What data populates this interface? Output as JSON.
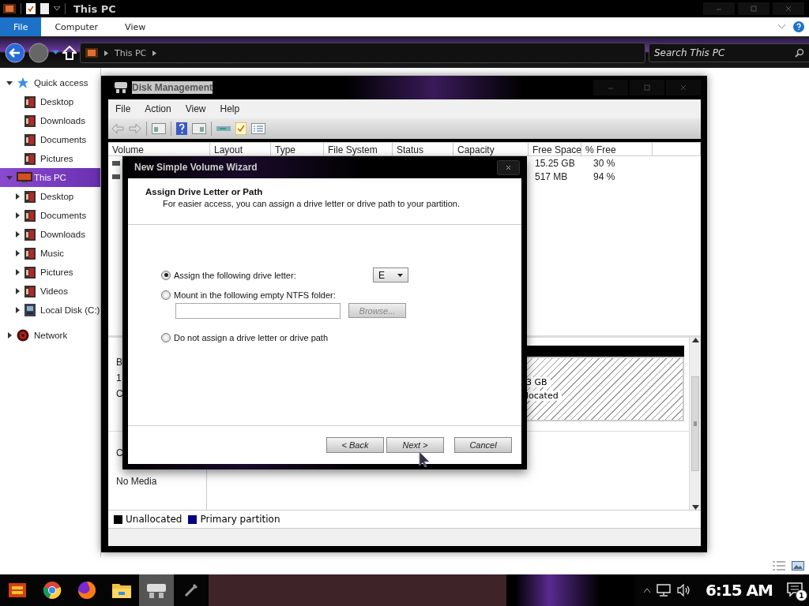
{
  "explorer": {
    "title": "This PC",
    "ribbon_tabs": [
      {
        "label": "File",
        "selected": true
      },
      {
        "label": "Computer",
        "selected": false
      },
      {
        "label": "View",
        "selected": false
      }
    ],
    "address": {
      "crumbs": [
        "This PC"
      ]
    },
    "search": {
      "placeholder": "Search This PC"
    },
    "sidebar": {
      "items": [
        {
          "label": "Quick access",
          "kind": "star",
          "expanded": true,
          "selected": false,
          "children": [
            {
              "label": "Desktop",
              "kind": "folder",
              "selected": false
            },
            {
              "label": "Downloads",
              "kind": "folder",
              "selected": false
            },
            {
              "label": "Documents",
              "kind": "folder",
              "selected": false
            },
            {
              "label": "Pictures",
              "kind": "folder",
              "selected": false
            }
          ]
        },
        {
          "label": "This PC",
          "kind": "computer",
          "expanded": true,
          "selected": true,
          "children": [
            {
              "label": "Desktop",
              "kind": "folder",
              "expanded": false,
              "selected": false
            },
            {
              "label": "Documents",
              "kind": "folder",
              "expanded": false,
              "selected": false
            },
            {
              "label": "Downloads",
              "kind": "folder",
              "expanded": false,
              "selected": false
            },
            {
              "label": "Music",
              "kind": "folder",
              "expanded": false,
              "selected": false
            },
            {
              "label": "Pictures",
              "kind": "folder",
              "expanded": false,
              "selected": false
            },
            {
              "label": "Videos",
              "kind": "folder",
              "expanded": false,
              "selected": false
            },
            {
              "label": "Local Disk (C:)",
              "kind": "drive",
              "expanded": false,
              "selected": false
            }
          ]
        },
        {
          "label": "Network",
          "kind": "network",
          "expanded": false,
          "selected": false
        }
      ]
    }
  },
  "disk_management": {
    "title": "Disk Management",
    "menu": [
      "File",
      "Action",
      "View",
      "Help"
    ],
    "columns": [
      "Volume",
      "Layout",
      "Type",
      "File System",
      "Status",
      "Capacity",
      "Free Space",
      "% Free"
    ],
    "rows": [
      {
        "free_space": "15.25 GB",
        "percent_free": "30 %"
      },
      {
        "free_space": "517 MB",
        "percent_free": "94 %"
      }
    ],
    "disks": [
      {
        "label_lines": [
          "B",
          "1",
          "C"
        ],
        "partition_lines": [
          "3 GB",
          "located"
        ]
      },
      {
        "label_lines": [
          "C",
          "No Media"
        ]
      }
    ],
    "legend": [
      {
        "label": "Unallocated",
        "color": "#000000"
      },
      {
        "label": "Primary partition",
        "color": "#000080"
      }
    ]
  },
  "wizard": {
    "title": "New Simple Volume Wizard",
    "heading": "Assign Drive Letter or Path",
    "description": "For easier access, you can assign a drive letter or drive path to your partition.",
    "options": [
      {
        "label": "Assign the following drive letter:",
        "selected": true
      },
      {
        "label": "Mount in the following empty NTFS folder:",
        "selected": false
      },
      {
        "label": "Do not assign a drive letter or drive path",
        "selected": false
      }
    ],
    "drive_letter": "E",
    "browse": {
      "label": "Browse...",
      "disabled": true
    },
    "buttons": [
      "< Back",
      "Next >",
      "Cancel"
    ]
  },
  "taskbar": {
    "clock": "6:15 AM",
    "notification_count": "1"
  }
}
